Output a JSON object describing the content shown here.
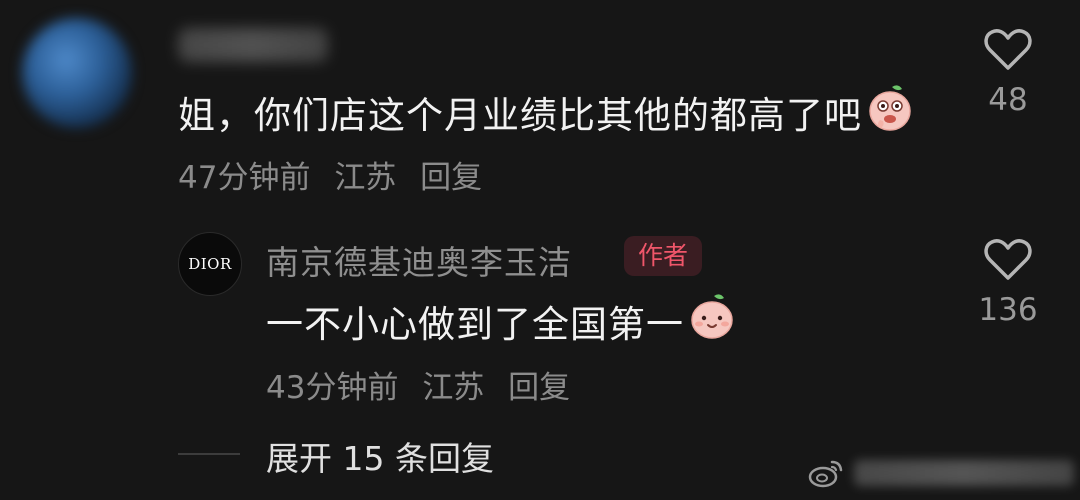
{
  "comment": {
    "text": "姐，你们店这个月业绩比其他的都高了吧",
    "time": "47分钟前",
    "location": "江苏",
    "reply_label": "回复",
    "likes": "48",
    "emoji_icon": "peach-shy-emoji-icon"
  },
  "reply": {
    "avatar_text": "DIOR",
    "username": "南京德基迪奥李玉洁",
    "badge": "作者",
    "text": "一不小心做到了全国第一",
    "time": "43分钟前",
    "location": "江苏",
    "reply_label": "回复",
    "likes": "136",
    "emoji_icon": "peach-smile-emoji-icon"
  },
  "expand": {
    "label": "展开 15 条回复"
  },
  "colors": {
    "background": "#161616",
    "text_primary": "#f2f2f2",
    "text_meta": "#8b8b8b",
    "badge_text": "#f0566a",
    "badge_bg": "#3a1d22"
  }
}
